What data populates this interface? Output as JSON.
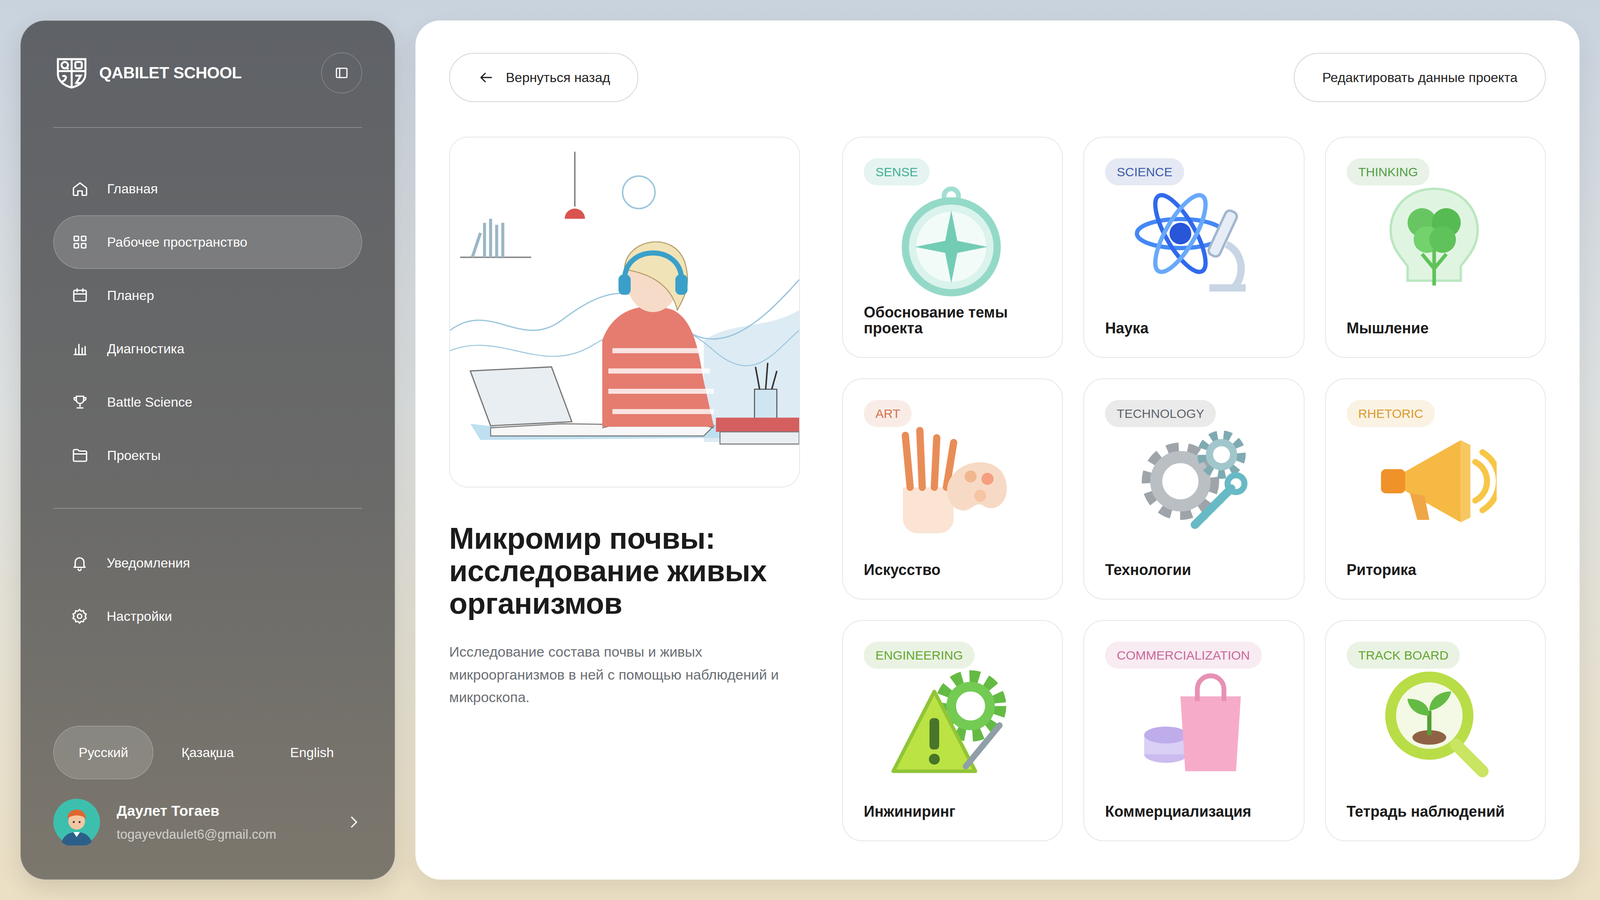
{
  "sidebar": {
    "brand": "QABILET SCHOOL",
    "items": [
      {
        "label": "Главная",
        "selected": false
      },
      {
        "label": "Рабочее пространство",
        "selected": true
      },
      {
        "label": "Планер",
        "selected": false
      },
      {
        "label": "Диагностика",
        "selected": false
      },
      {
        "label": "Battle Science",
        "selected": false
      },
      {
        "label": "Проекты",
        "selected": false
      }
    ],
    "bottom_items": [
      {
        "label": "Уведомления"
      },
      {
        "label": "Настройки"
      }
    ],
    "languages": [
      {
        "label": "Русский",
        "selected": true
      },
      {
        "label": "Қазақша",
        "selected": false
      },
      {
        "label": "English",
        "selected": false
      }
    ],
    "user": {
      "name": "Даулет Тогаев",
      "email": "togayevdaulet6@gmail.com"
    }
  },
  "header": {
    "back": "Вернуться назад",
    "edit": "Редактировать данные проекта"
  },
  "project": {
    "title": "Микромир почвы: исследование живых организмов",
    "description": "Исследование состава почвы и живых микроорганизмов в ней с помощью наблюдений и микроскопа."
  },
  "cards": [
    {
      "badge": "SENSE",
      "label": "Обоснование темы проекта",
      "color": "#3fae95"
    },
    {
      "badge": "SCIENCE",
      "label": "Наука",
      "color": "#3d5aa8"
    },
    {
      "badge": "THINKING",
      "label": "Мышление",
      "color": "#4f9e45"
    },
    {
      "badge": "ART",
      "label": "Искусство",
      "color": "#d4714a"
    },
    {
      "badge": "TECHNOLOGY",
      "label": "Технологии",
      "color": "#5f6368"
    },
    {
      "badge": "RHETORIC",
      "label": "Риторика",
      "color": "#d99a2b"
    },
    {
      "badge": "ENGINEERING",
      "label": "Инжиниринг",
      "color": "#62a52f"
    },
    {
      "badge": "COMMERCIALIZATION",
      "label": "Коммерциализация",
      "color": "#c8679a"
    },
    {
      "badge": "TRACK BOARD",
      "label": "Тетрадь наблюдений",
      "color": "#62a52f"
    }
  ]
}
